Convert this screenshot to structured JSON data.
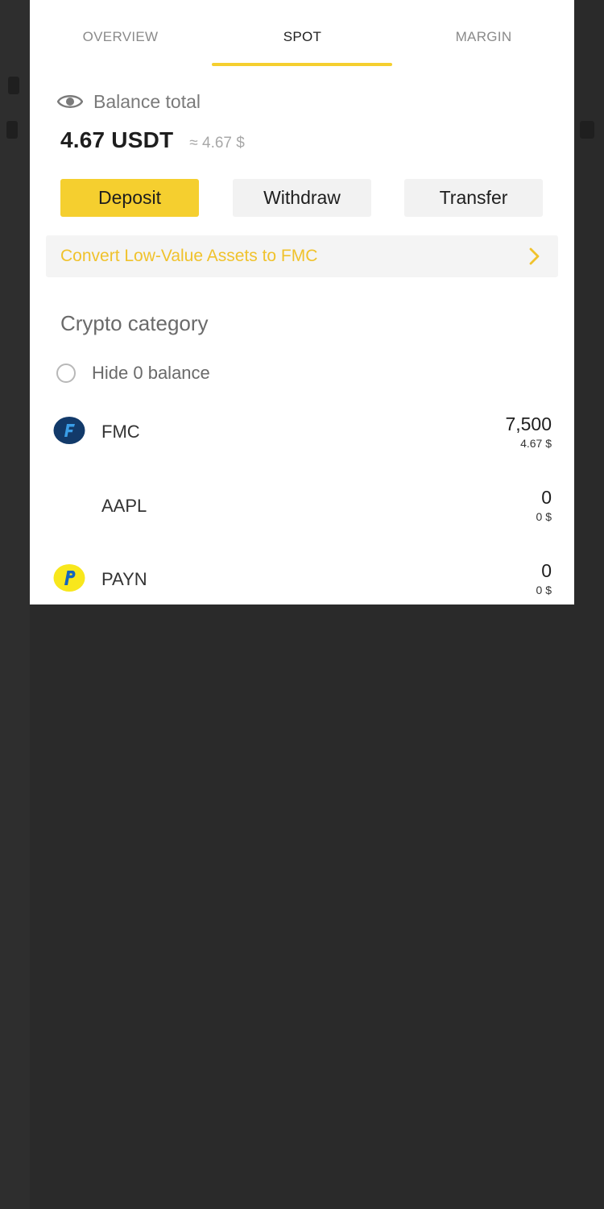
{
  "tabs": [
    {
      "label": "OVERVIEW",
      "active": false
    },
    {
      "label": "SPOT",
      "active": true
    },
    {
      "label": "MARGIN",
      "active": false
    }
  ],
  "balance": {
    "label": "Balance total",
    "amount": "4.67 USDT",
    "approx": "≈ 4.67 $"
  },
  "actions": {
    "deposit": "Deposit",
    "withdraw": "Withdraw",
    "transfer": "Transfer"
  },
  "convert": {
    "text": "Convert Low-Value Assets to FMC"
  },
  "category": {
    "title": "Crypto category",
    "hide_zero_label": "Hide 0 balance",
    "hide_zero_checked": false
  },
  "assets": [
    {
      "symbol": "FMC",
      "quantity": "7,500",
      "usd_value": "4.67 $",
      "icon": "fmc-logo-icon"
    },
    {
      "symbol": "AAPL",
      "quantity": "0",
      "usd_value": "0 $",
      "icon": ""
    },
    {
      "symbol": "PAYN",
      "quantity": "0",
      "usd_value": "0 $",
      "icon": "payn-logo-icon"
    }
  ],
  "colors": {
    "accent": "#f5cf2f",
    "accent_text": "#f0c22c",
    "button_neutral": "#f2f2f2"
  }
}
